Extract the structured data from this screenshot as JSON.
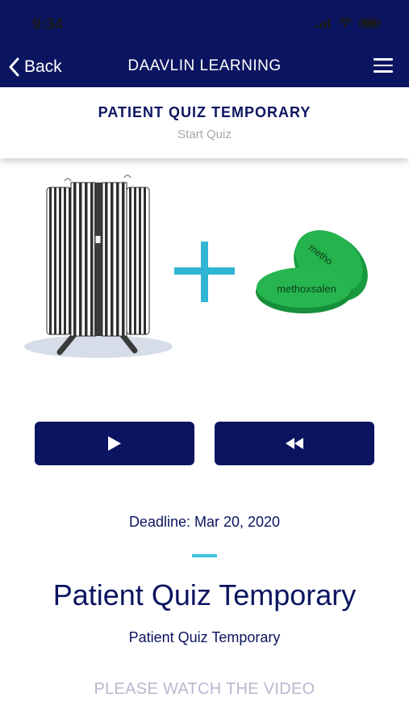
{
  "status_bar": {
    "time": "9:34"
  },
  "nav": {
    "back_label": "Back",
    "title": "DAAVLIN LEARNING"
  },
  "header": {
    "title": "PATIENT QUIZ TEMPORARY",
    "subtitle": "Start Quiz"
  },
  "hero": {
    "pill_text_front": "methoxsalen",
    "pill_text_back": "metho"
  },
  "controls": {
    "play_icon": "play-icon",
    "rewind_icon": "rewind-icon"
  },
  "quiz": {
    "deadline": "Deadline: Mar 20, 2020",
    "title": "Patient Quiz Temporary",
    "description": "Patient Quiz Temporary",
    "watch_prompt": "PLEASE WATCH THE VIDEO"
  },
  "colors": {
    "primary": "#0b1460",
    "accent": "#3cc5df",
    "pill_green": "#20a84a",
    "muted": "#b6b8cf"
  }
}
